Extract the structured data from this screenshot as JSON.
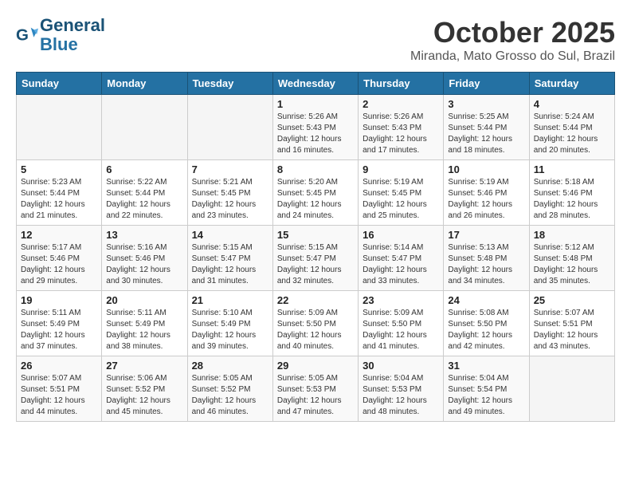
{
  "header": {
    "logo_line1": "General",
    "logo_line2": "Blue",
    "month": "October 2025",
    "location": "Miranda, Mato Grosso do Sul, Brazil"
  },
  "weekdays": [
    "Sunday",
    "Monday",
    "Tuesday",
    "Wednesday",
    "Thursday",
    "Friday",
    "Saturday"
  ],
  "weeks": [
    [
      {
        "day": "",
        "info": ""
      },
      {
        "day": "",
        "info": ""
      },
      {
        "day": "",
        "info": ""
      },
      {
        "day": "1",
        "info": "Sunrise: 5:26 AM\nSunset: 5:43 PM\nDaylight: 12 hours\nand 16 minutes."
      },
      {
        "day": "2",
        "info": "Sunrise: 5:26 AM\nSunset: 5:43 PM\nDaylight: 12 hours\nand 17 minutes."
      },
      {
        "day": "3",
        "info": "Sunrise: 5:25 AM\nSunset: 5:44 PM\nDaylight: 12 hours\nand 18 minutes."
      },
      {
        "day": "4",
        "info": "Sunrise: 5:24 AM\nSunset: 5:44 PM\nDaylight: 12 hours\nand 20 minutes."
      }
    ],
    [
      {
        "day": "5",
        "info": "Sunrise: 5:23 AM\nSunset: 5:44 PM\nDaylight: 12 hours\nand 21 minutes."
      },
      {
        "day": "6",
        "info": "Sunrise: 5:22 AM\nSunset: 5:44 PM\nDaylight: 12 hours\nand 22 minutes."
      },
      {
        "day": "7",
        "info": "Sunrise: 5:21 AM\nSunset: 5:45 PM\nDaylight: 12 hours\nand 23 minutes."
      },
      {
        "day": "8",
        "info": "Sunrise: 5:20 AM\nSunset: 5:45 PM\nDaylight: 12 hours\nand 24 minutes."
      },
      {
        "day": "9",
        "info": "Sunrise: 5:19 AM\nSunset: 5:45 PM\nDaylight: 12 hours\nand 25 minutes."
      },
      {
        "day": "10",
        "info": "Sunrise: 5:19 AM\nSunset: 5:46 PM\nDaylight: 12 hours\nand 26 minutes."
      },
      {
        "day": "11",
        "info": "Sunrise: 5:18 AM\nSunset: 5:46 PM\nDaylight: 12 hours\nand 28 minutes."
      }
    ],
    [
      {
        "day": "12",
        "info": "Sunrise: 5:17 AM\nSunset: 5:46 PM\nDaylight: 12 hours\nand 29 minutes."
      },
      {
        "day": "13",
        "info": "Sunrise: 5:16 AM\nSunset: 5:46 PM\nDaylight: 12 hours\nand 30 minutes."
      },
      {
        "day": "14",
        "info": "Sunrise: 5:15 AM\nSunset: 5:47 PM\nDaylight: 12 hours\nand 31 minutes."
      },
      {
        "day": "15",
        "info": "Sunrise: 5:15 AM\nSunset: 5:47 PM\nDaylight: 12 hours\nand 32 minutes."
      },
      {
        "day": "16",
        "info": "Sunrise: 5:14 AM\nSunset: 5:47 PM\nDaylight: 12 hours\nand 33 minutes."
      },
      {
        "day": "17",
        "info": "Sunrise: 5:13 AM\nSunset: 5:48 PM\nDaylight: 12 hours\nand 34 minutes."
      },
      {
        "day": "18",
        "info": "Sunrise: 5:12 AM\nSunset: 5:48 PM\nDaylight: 12 hours\nand 35 minutes."
      }
    ],
    [
      {
        "day": "19",
        "info": "Sunrise: 5:11 AM\nSunset: 5:49 PM\nDaylight: 12 hours\nand 37 minutes."
      },
      {
        "day": "20",
        "info": "Sunrise: 5:11 AM\nSunset: 5:49 PM\nDaylight: 12 hours\nand 38 minutes."
      },
      {
        "day": "21",
        "info": "Sunrise: 5:10 AM\nSunset: 5:49 PM\nDaylight: 12 hours\nand 39 minutes."
      },
      {
        "day": "22",
        "info": "Sunrise: 5:09 AM\nSunset: 5:50 PM\nDaylight: 12 hours\nand 40 minutes."
      },
      {
        "day": "23",
        "info": "Sunrise: 5:09 AM\nSunset: 5:50 PM\nDaylight: 12 hours\nand 41 minutes."
      },
      {
        "day": "24",
        "info": "Sunrise: 5:08 AM\nSunset: 5:50 PM\nDaylight: 12 hours\nand 42 minutes."
      },
      {
        "day": "25",
        "info": "Sunrise: 5:07 AM\nSunset: 5:51 PM\nDaylight: 12 hours\nand 43 minutes."
      }
    ],
    [
      {
        "day": "26",
        "info": "Sunrise: 5:07 AM\nSunset: 5:51 PM\nDaylight: 12 hours\nand 44 minutes."
      },
      {
        "day": "27",
        "info": "Sunrise: 5:06 AM\nSunset: 5:52 PM\nDaylight: 12 hours\nand 45 minutes."
      },
      {
        "day": "28",
        "info": "Sunrise: 5:05 AM\nSunset: 5:52 PM\nDaylight: 12 hours\nand 46 minutes."
      },
      {
        "day": "29",
        "info": "Sunrise: 5:05 AM\nSunset: 5:53 PM\nDaylight: 12 hours\nand 47 minutes."
      },
      {
        "day": "30",
        "info": "Sunrise: 5:04 AM\nSunset: 5:53 PM\nDaylight: 12 hours\nand 48 minutes."
      },
      {
        "day": "31",
        "info": "Sunrise: 5:04 AM\nSunset: 5:54 PM\nDaylight: 12 hours\nand 49 minutes."
      },
      {
        "day": "",
        "info": ""
      }
    ]
  ]
}
